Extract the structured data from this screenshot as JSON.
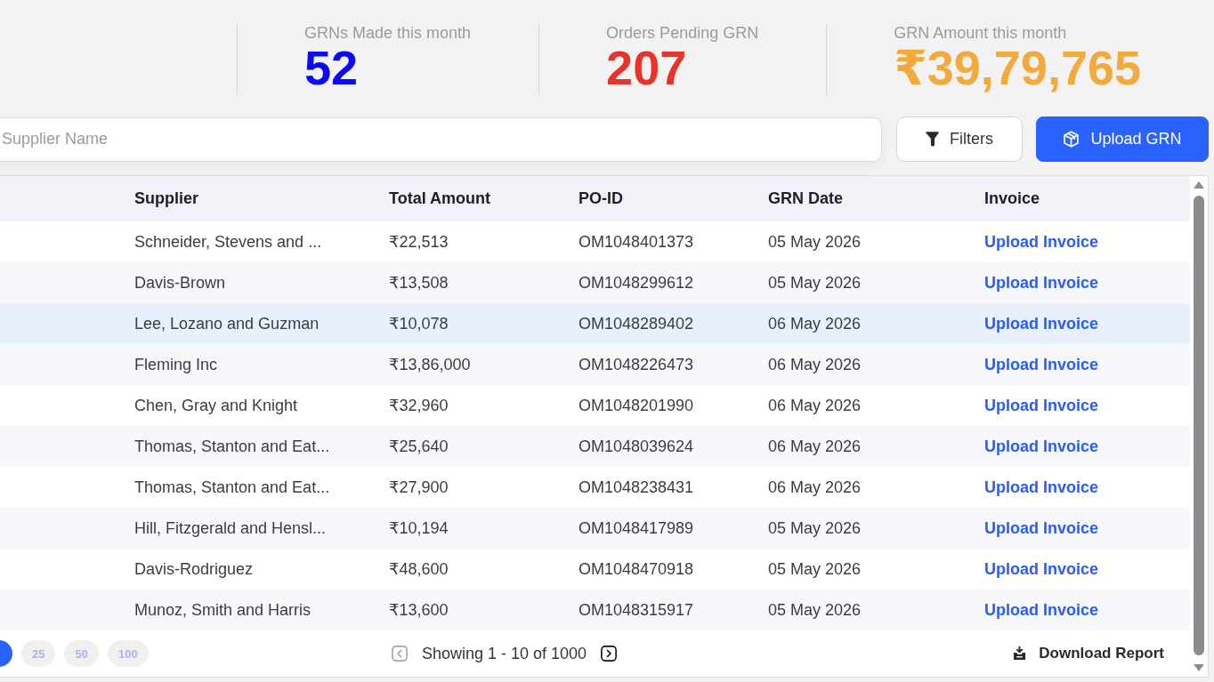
{
  "stats": [
    {
      "label": "GRNs Made this month",
      "value": "52",
      "color": "#0a0af5"
    },
    {
      "label": "Orders Pending GRN",
      "value": "207",
      "color": "#e8322a"
    },
    {
      "label": "GRN Amount this month",
      "value": "₹39,79,765",
      "color": "#f4a93c"
    }
  ],
  "search": {
    "placeholder": "Supplier Name"
  },
  "buttons": [
    {
      "label": "Filters",
      "kind": "secondary"
    },
    {
      "label": "Upload GRN",
      "kind": "primary"
    }
  ],
  "table": {
    "columns": [
      "Supplier",
      "Total Amount",
      "PO-ID",
      "GRN Date",
      "Invoice"
    ],
    "rows": [
      {
        "supplier": "Schneider, Stevens and ...",
        "total_amount": "₹22,513",
        "po_id": "OM1048401373",
        "grn_date": "05 May 2026",
        "invoice": "Upload Invoice",
        "selected": false
      },
      {
        "supplier": "Davis-Brown",
        "total_amount": "₹13,508",
        "po_id": "OM1048299612",
        "grn_date": "05 May 2026",
        "invoice": "Upload Invoice",
        "selected": false
      },
      {
        "supplier": "Lee, Lozano and Guzman",
        "total_amount": "₹10,078",
        "po_id": "OM1048289402",
        "grn_date": "06 May 2026",
        "invoice": "Upload Invoice",
        "selected": true
      },
      {
        "supplier": "Fleming Inc",
        "total_amount": "₹13,86,000",
        "po_id": "OM1048226473",
        "grn_date": "06 May 2026",
        "invoice": "Upload Invoice",
        "selected": false
      },
      {
        "supplier": "Chen, Gray and Knight",
        "total_amount": "₹32,960",
        "po_id": "OM1048201990",
        "grn_date": "06 May 2026",
        "invoice": "Upload Invoice",
        "selected": false
      },
      {
        "supplier": "Thomas, Stanton and Eat...",
        "total_amount": "₹25,640",
        "po_id": "OM1048039624",
        "grn_date": "06 May 2026",
        "invoice": "Upload Invoice",
        "selected": false
      },
      {
        "supplier": "Thomas, Stanton and Eat...",
        "total_amount": "₹27,900",
        "po_id": "OM1048238431",
        "grn_date": "06 May 2026",
        "invoice": "Upload Invoice",
        "selected": false
      },
      {
        "supplier": "Hill, Fitzgerald and Hensl...",
        "total_amount": "₹10,194",
        "po_id": "OM1048417989",
        "grn_date": "05 May 2026",
        "invoice": "Upload Invoice",
        "selected": false
      },
      {
        "supplier": "Davis-Rodriguez",
        "total_amount": "₹48,600",
        "po_id": "OM1048470918",
        "grn_date": "05 May 2026",
        "invoice": "Upload Invoice",
        "selected": false
      },
      {
        "supplier": "Munoz, Smith and Harris",
        "total_amount": "₹13,600",
        "po_id": "OM1048315917",
        "grn_date": "05 May 2026",
        "invoice": "Upload Invoice",
        "selected": false
      }
    ]
  },
  "footer": {
    "page_sizes": [
      {
        "selected": true
      },
      {
        "label": "25",
        "selected": false
      },
      {
        "label": "50",
        "selected": false
      },
      {
        "label": "100",
        "selected": false
      }
    ],
    "pagination": {
      "previous": {
        "disabled": true
      },
      "text": "Showing 1 - 10 of 1000",
      "next": {
        "disabled": false
      }
    },
    "download": "Download Report"
  }
}
